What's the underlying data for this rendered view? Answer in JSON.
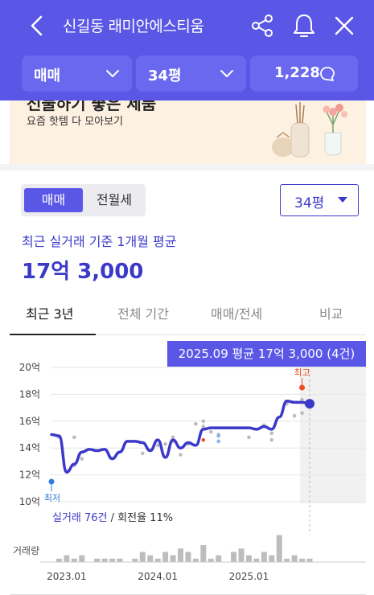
{
  "header": {
    "title": "신길동 래미안에스티움",
    "filters": {
      "trade_type": "매매",
      "size": "34평",
      "count": "1,228"
    }
  },
  "banner": {
    "title": "선물하기 좋은 제품",
    "subtitle": "요즘 핫템 다 모아보기"
  },
  "segment": {
    "selected": "매매",
    "other": "전월세"
  },
  "size_select": "34평",
  "average": {
    "label": "최근 실거래 기준 1개월 평균",
    "price": "17억 3,000"
  },
  "tabs": [
    "최근 3년",
    "전체 기간",
    "매매/전세",
    "비교"
  ],
  "tooltip": "2025.09 평균 17억 3,000 (4건)",
  "min_label": "최저",
  "max_label": "최고",
  "deals": {
    "count_text": "실거래 76건",
    "rate_text": " / 회전율 11%"
  },
  "volume_label": "거래량",
  "colors": {
    "brand": "#5a57e6",
    "line": "#3b39c8",
    "max_marker": "#f04e23",
    "min_marker": "#2d7be0"
  },
  "chart_data": {
    "type": "line",
    "title": "",
    "ylabel": "",
    "ylim": [
      10,
      20
    ],
    "y_ticks": [
      "20억",
      "18억",
      "16억",
      "14억",
      "12억",
      "10억"
    ],
    "x_ticks": [
      "2023.01",
      "2024.01",
      "2025.01"
    ],
    "series": [
      {
        "values": [
          {
            "x": "2022.11",
            "y": 15.0
          },
          {
            "x": "2022.12",
            "y": 14.9
          },
          {
            "x": "2023.01",
            "y": 12.2
          },
          {
            "x": "2023.02",
            "y": 12.8
          },
          {
            "x": "2023.03",
            "y": 13.7
          },
          {
            "x": "2023.04",
            "y": 13.9
          },
          {
            "x": "2023.05",
            "y": 13.8
          },
          {
            "x": "2023.06",
            "y": 13.9
          },
          {
            "x": "2023.07",
            "y": 13.2
          },
          {
            "x": "2023.08",
            "y": 13.7
          },
          {
            "x": "2023.09",
            "y": 14.5
          },
          {
            "x": "2023.10",
            "y": 14.5
          },
          {
            "x": "2023.11",
            "y": 14.4
          },
          {
            "x": "2023.12",
            "y": 13.8
          },
          {
            "x": "2024.01",
            "y": 14.6
          },
          {
            "x": "2024.02",
            "y": 13.3
          },
          {
            "x": "2024.03",
            "y": 14.6
          },
          {
            "x": "2024.04",
            "y": 14.0
          },
          {
            "x": "2024.05",
            "y": 14.4
          },
          {
            "x": "2024.06",
            "y": 14.2
          },
          {
            "x": "2024.07",
            "y": 15.4
          },
          {
            "x": "2024.08",
            "y": 15.5
          },
          {
            "x": "2024.09",
            "y": 15.5
          },
          {
            "x": "2024.10",
            "y": 15.5
          },
          {
            "x": "2024.11",
            "y": 15.5
          },
          {
            "x": "2024.12",
            "y": 15.5
          },
          {
            "x": "2025.01",
            "y": 15.5
          },
          {
            "x": "2025.02",
            "y": 15.4
          },
          {
            "x": "2025.03",
            "y": 15.6
          },
          {
            "x": "2025.04",
            "y": 15.4
          },
          {
            "x": "2025.05",
            "y": 16.3
          },
          {
            "x": "2025.06",
            "y": 17.5
          },
          {
            "x": "2025.07",
            "y": 17.4
          },
          {
            "x": "2025.08",
            "y": 17.4
          },
          {
            "x": "2025.09",
            "y": 17.3
          }
        ]
      }
    ],
    "min_point": {
      "x": "2022.11",
      "y": 11.5
    },
    "max_point": {
      "x": "2025.08",
      "y": 18.5
    },
    "scatter_points": [
      {
        "x": "2022.12",
        "y": 14.8
      },
      {
        "x": "2023.01",
        "y": 12.3
      },
      {
        "x": "2023.02",
        "y": 14.8
      },
      {
        "x": "2023.03",
        "y": 13.2
      },
      {
        "x": "2023.02",
        "y": 12.7
      },
      {
        "x": "2023.11",
        "y": 13.6
      },
      {
        "x": "2024.01",
        "y": 14.2
      },
      {
        "x": "2024.02",
        "y": 14.3
      },
      {
        "x": "2024.03",
        "y": 14.5
      },
      {
        "x": "2024.03",
        "y": 14.8
      },
      {
        "x": "2024.04",
        "y": 13.5
      },
      {
        "x": "2024.05",
        "y": 14.3
      },
      {
        "x": "2024.06",
        "y": 15.8
      },
      {
        "x": "2024.07",
        "y": 15.6
      },
      {
        "x": "2024.07",
        "y": 16.0
      },
      {
        "x": "2024.08",
        "y": 15.2
      },
      {
        "x": "2024.09",
        "y": 15.0
      },
      {
        "x": "2025.01",
        "y": 14.8
      },
      {
        "x": "2025.03",
        "y": 15.7
      },
      {
        "x": "2025.04",
        "y": 15.1
      },
      {
        "x": "2025.04",
        "y": 14.6
      },
      {
        "x": "2025.06",
        "y": 17.3
      },
      {
        "x": "2025.08",
        "y": 17.6
      },
      {
        "x": "2025.08",
        "y": 16.6
      },
      {
        "x": "2025.07",
        "y": 16.4
      }
    ],
    "volume": [
      0,
      1,
      2,
      1,
      2,
      0,
      1,
      1,
      1,
      1,
      0,
      1,
      3,
      2,
      1,
      3,
      2,
      4,
      3,
      1,
      5,
      1,
      2,
      0,
      3,
      4,
      2,
      1,
      3,
      2,
      8,
      1,
      2,
      1,
      1
    ]
  }
}
